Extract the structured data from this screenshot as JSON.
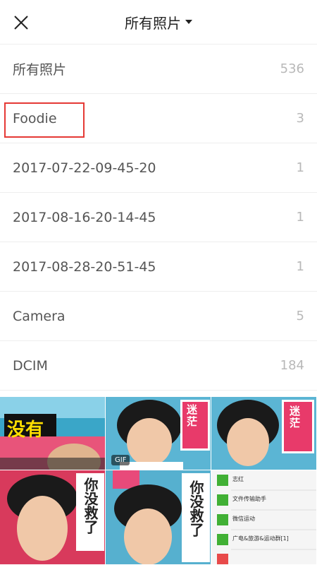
{
  "header": {
    "title": "所有照片"
  },
  "albums": [
    {
      "name": "所有照片",
      "count": "536"
    },
    {
      "name": "Foodie",
      "count": "3"
    },
    {
      "name": "2017-07-22-09-45-20",
      "count": "1"
    },
    {
      "name": "2017-08-16-20-14-45",
      "count": "1"
    },
    {
      "name": "2017-08-28-20-51-45",
      "count": "1"
    },
    {
      "name": "Camera",
      "count": "5"
    },
    {
      "name": "DCIM",
      "count": "184"
    }
  ],
  "grid": {
    "tile1_text": "没有",
    "tile2_badge": "GIF",
    "tile2_stamp": "迷茫",
    "tile3_stamp": "迷茫",
    "tile4_text": "你没救了",
    "tile5_text": "你没救了",
    "chat_items": [
      "文件传输助手",
      "微信运动",
      "志红",
      "广电&旅游&运动群[1]"
    ]
  },
  "colors": {
    "highlight": "#e53935",
    "count_gray": "#b8b8b8",
    "divider": "#eeeeee"
  }
}
